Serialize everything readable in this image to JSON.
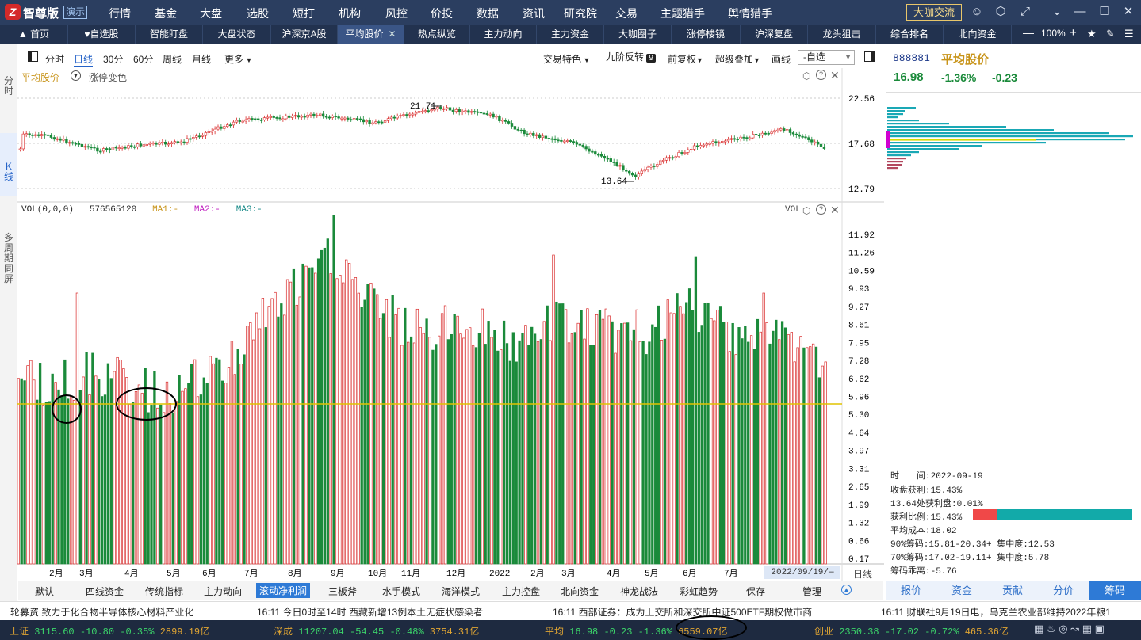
{
  "app": {
    "logo_char": "Z",
    "name": "智尊版",
    "edition": "演示",
    "menu": [
      "行情",
      "基金",
      "大盘",
      "选股",
      "短打",
      "机构",
      "风控",
      "价投",
      "数据",
      "资讯",
      "研究院",
      "交易",
      "主题猎手",
      "舆情猎手"
    ],
    "community": "大咖交流"
  },
  "tabs": {
    "items": [
      "首页",
      "自选股",
      "智能盯盘",
      "大盘状态",
      "沪深京A股",
      "平均股价",
      "热点纵览",
      "主力动向",
      "主力资金",
      "大咖圈子",
      "涨停楼镜",
      "沪深复盘",
      "龙头狙击",
      "综合排名",
      "北向资金"
    ],
    "active": "平均股价",
    "zoom": "100%"
  },
  "left_rail": [
    "分时",
    "K线",
    "多周期同屏"
  ],
  "toolbar": {
    "periods": [
      "分时",
      "日线",
      "30分",
      "60分",
      "周线",
      "月线",
      "更多"
    ],
    "active_period": "日线",
    "right": [
      "交易特色",
      "九阶反转",
      "前复权",
      "超级叠加",
      "画线"
    ],
    "nine_badge": "9",
    "stock_select": "-自选"
  },
  "kline": {
    "name": "平均股价",
    "option": "涨停变色",
    "y_ticks": [
      "22.56",
      "17.68",
      "12.79"
    ],
    "high_label": "21.71",
    "low_label": "13.64"
  },
  "volume": {
    "header": "VOL(0,0,0)",
    "value": "576565120",
    "ma1": "MA1:-",
    "ma2": "MA2:-",
    "ma3": "MA3:-",
    "tag": "VOL",
    "y_ticks": [
      "11.92",
      "11.26",
      "10.59",
      "9.93",
      "9.27",
      "8.61",
      "7.95",
      "7.28",
      "6.62",
      "5.96",
      "5.30",
      "4.64",
      "3.97",
      "3.31",
      "2.65",
      "1.99",
      "1.32",
      "0.66",
      "0.17"
    ]
  },
  "x_axis": {
    "months": [
      "2月",
      "3月",
      "4月",
      "5月",
      "6月",
      "7月",
      "8月",
      "9月",
      "10月",
      "11月",
      "12月",
      "2022",
      "2月",
      "3月",
      "4月",
      "5月",
      "6月",
      "7月"
    ],
    "cursor_date": "2022/09/19/—",
    "mode": "日线"
  },
  "quote": {
    "code": "888881",
    "name": "平均股价",
    "price": "16.98",
    "change_pct": "-1.36%",
    "change": "-0.23"
  },
  "chips": {
    "lines": [
      "时　　间:2022-09-19",
      "收盘获利:15.43%",
      "13.64处获利盘:0.01%",
      "获利比例:15.43%",
      "平均成本:18.02",
      "90%筹码:15.81-20.34+ 集中度:12.53",
      "70%筹码:17.02-19.11+ 集中度:5.78",
      "筹码乖离:-5.76"
    ],
    "profit_ratio": 0.1543
  },
  "bottom_tabs": {
    "items": [
      "默认",
      "四线资金",
      "传统指标",
      "主力动向",
      "滚动净利润",
      "三板斧",
      "水手模式",
      "海洋模式",
      "主力控盘",
      "北向资金",
      "神龙战法",
      "彩虹趋势",
      "保存",
      "管理"
    ],
    "active": "滚动净利润"
  },
  "right_tabs": {
    "items": [
      "报价",
      "资金",
      "贡献",
      "分价",
      "筹码"
    ],
    "active": "筹码"
  },
  "news": [
    "轮募资 致力于化合物半导体核心材料产业化",
    "16:11 今日0时至14时 西藏新增13例本土无症状感染者",
    "16:11 西部证券：成为上交所和深交所中证500ETF期权做市商",
    "16:11 财联社9月19日电，乌克兰农业部维持2022年粮1"
  ],
  "status": [
    {
      "name": "上证",
      "value": "3115.60",
      "chg": "-10.80",
      "pct": "-0.35%",
      "amount": "2899.19亿"
    },
    {
      "name": "深成",
      "value": "11207.04",
      "chg": "-54.45",
      "pct": "-0.48%",
      "amount": "3754.31亿"
    },
    {
      "name": "平均",
      "value": "16.98",
      "chg": "-0.23",
      "pct": "-1.36%",
      "amount": "6559.07亿"
    },
    {
      "name": "创业",
      "value": "2350.38",
      "chg": "-17.02",
      "pct": "-0.72%",
      "amount": "465.36亿"
    }
  ],
  "colors": {
    "up": "#d92b2b",
    "down": "#1a8a3a",
    "accent": "#2e7ad6",
    "header": "#2b3e60"
  }
}
